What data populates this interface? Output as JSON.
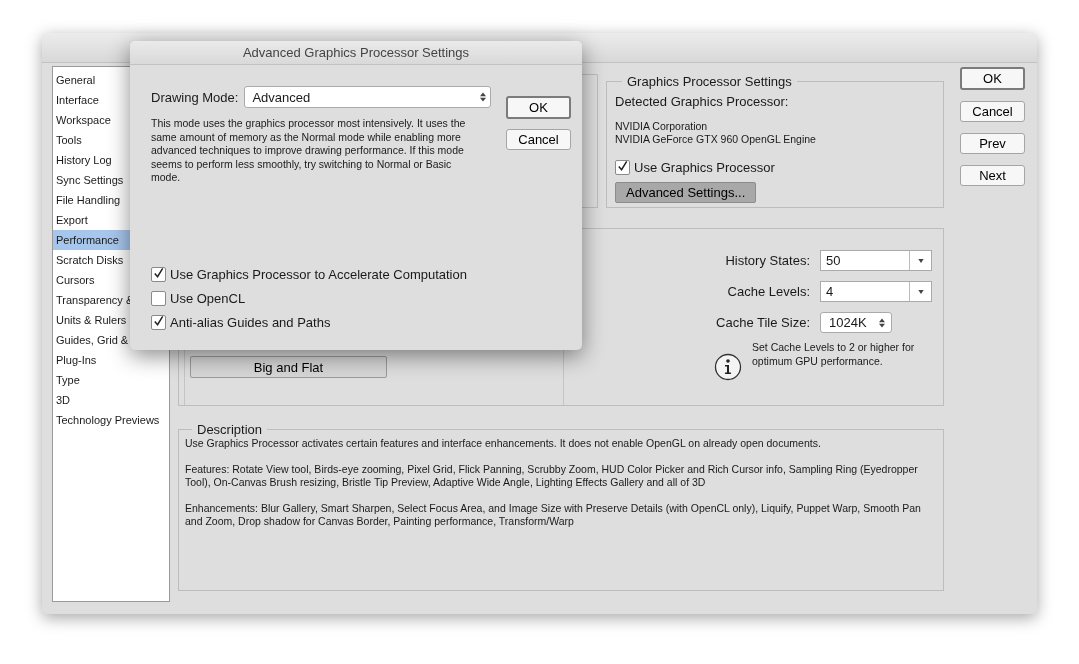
{
  "sidebar": {
    "items": [
      {
        "label": "General",
        "selected": false
      },
      {
        "label": "Interface",
        "selected": false
      },
      {
        "label": "Workspace",
        "selected": false
      },
      {
        "label": "Tools",
        "selected": false
      },
      {
        "label": "History Log",
        "selected": false
      },
      {
        "label": "Sync Settings",
        "selected": false
      },
      {
        "label": "File Handling",
        "selected": false
      },
      {
        "label": "Export",
        "selected": false
      },
      {
        "label": "Performance",
        "selected": true
      },
      {
        "label": "Scratch Disks",
        "selected": false
      },
      {
        "label": "Cursors",
        "selected": false
      },
      {
        "label": "Transparency &",
        "selected": false
      },
      {
        "label": "Units & Rulers",
        "selected": false
      },
      {
        "label": "Guides, Grid &",
        "selected": false
      },
      {
        "label": "Plug-Ins",
        "selected": false
      },
      {
        "label": "Type",
        "selected": false
      },
      {
        "label": "3D",
        "selected": false
      },
      {
        "label": "Technology Previews",
        "selected": false
      }
    ]
  },
  "gpu_settings": {
    "title": "Graphics Processor Settings",
    "detected_label": "Detected Graphics Processor:",
    "vendor": "NVIDIA Corporation",
    "renderer": "NVIDIA GeForce GTX 960 OpenGL Engine",
    "use_gpu": {
      "label": "Use Graphics Processor",
      "checked": true
    },
    "advanced_button": "Advanced Settings..."
  },
  "buttons": [
    "OK",
    "Cancel",
    "Prev",
    "Next"
  ],
  "history_cache": {
    "fields": [
      {
        "kind": "combo",
        "label": "History States:",
        "value": "50"
      },
      {
        "kind": "combo",
        "label": "Cache Levels:",
        "value": "4"
      },
      {
        "kind": "stepper",
        "label": "Cache Tile Size:",
        "value": "1024K"
      }
    ],
    "info": "Set Cache Levels to 2 or higher for optimum GPU performance.",
    "preset_button": "Big and Flat"
  },
  "description": {
    "title": "Description",
    "paragraphs": [
      "Use Graphics Processor activates certain features and interface enhancements. It does not enable OpenGL on already open documents.",
      "Features: Rotate View tool, Birds-eye zooming, Pixel Grid, Flick Panning, Scrubby Zoom, HUD Color Picker and Rich Cursor info, Sampling Ring (Eyedropper Tool), On-Canvas Brush resizing, Bristle Tip Preview, Adaptive Wide Angle, Lighting Effects Gallery and all of 3D",
      "Enhancements: Blur Gallery, Smart Sharpen, Select Focus Area, and Image Size with Preserve Details (with OpenCL only), Liquify, Puppet Warp, Smooth Pan and Zoom, Drop shadow for Canvas Border, Painting performance, Transform/Warp"
    ]
  },
  "dialog": {
    "title": "Advanced Graphics Processor Settings",
    "drawing_mode": {
      "label": "Drawing Mode:",
      "value": "Advanced"
    },
    "explanation": "This mode uses the graphics processor most intensively.  It uses the same amount of memory as the Normal mode while enabling more advanced techniques to improve drawing performance.  If this mode seems to perform less smoothly, try switching to Normal or Basic mode.",
    "buttons": [
      "OK",
      "Cancel"
    ],
    "options": [
      {
        "label": "Use Graphics Processor to Accelerate Computation",
        "checked": true
      },
      {
        "label": "Use OpenCL",
        "checked": false
      },
      {
        "label": "Anti-alias Guides and Paths",
        "checked": true
      }
    ]
  }
}
